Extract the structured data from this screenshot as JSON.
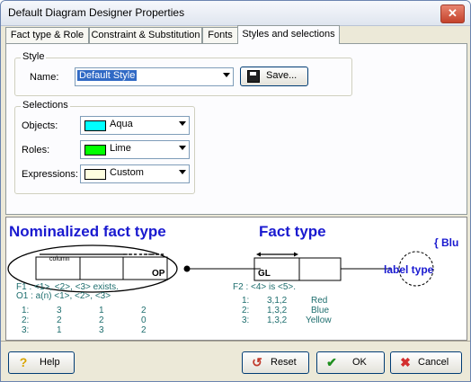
{
  "window": {
    "title": "Default Diagram Designer Properties"
  },
  "tabs": [
    {
      "label": "Fact type & Role"
    },
    {
      "label": "Constraint & Substitution"
    },
    {
      "label": "Fonts"
    },
    {
      "label": "Styles and selections"
    }
  ],
  "style_group": {
    "label": "Style",
    "name_label": "Name:",
    "name_value": "Default Style",
    "save_label": "Save..."
  },
  "selections_group": {
    "label": "Selections",
    "objects": {
      "label": "Objects:",
      "value": "Aqua",
      "color": "#00ffff"
    },
    "roles": {
      "label": "Roles:",
      "value": "Lime",
      "color": "#00ff00"
    },
    "expressions": {
      "label": "Expressions:",
      "value": "Custom",
      "color": "#ffffe0"
    }
  },
  "preview": {
    "nominalized_title": "Nominalized fact type",
    "fact_type_title": "Fact type",
    "brace_text": "{ Blu",
    "label_type": "label type",
    "column_label": "column",
    "op_label": "OP",
    "gl_label": "GL",
    "f1_text": "F1 : <1>, <2>, <3> exists.",
    "o1_text": "O1 : a(n) <1>, <2>, <3>",
    "f2_text": "F2 : <4> is <5>.",
    "table1": [
      [
        "1:",
        "3",
        "1",
        "2"
      ],
      [
        "2:",
        "2",
        "2",
        "0"
      ],
      [
        "3:",
        "1",
        "3",
        "2"
      ]
    ],
    "table2": [
      [
        "1:",
        "3,1,2",
        "Red"
      ],
      [
        "2:",
        "1,3,2",
        "Blue"
      ],
      [
        "3:",
        "1,3,2",
        "Yellow"
      ]
    ],
    "accent_color": "#1a1ad0",
    "teal_color": "#1e6e6e"
  },
  "buttons": {
    "help": "Help",
    "reset": "Reset",
    "ok": "OK",
    "cancel": "Cancel"
  }
}
